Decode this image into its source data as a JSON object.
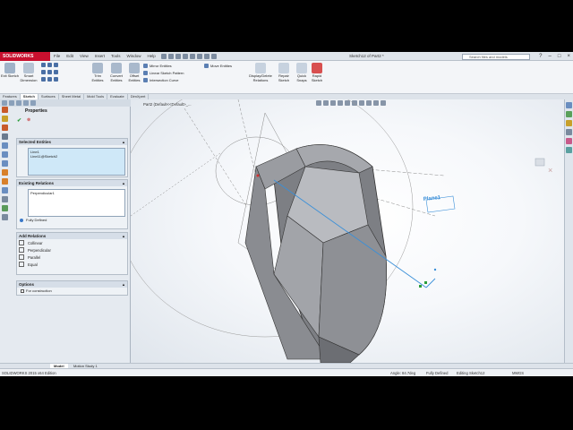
{
  "app": {
    "brand": "SOLIDWORKS",
    "document_title": "Sketch12 of Part2 *",
    "menu": [
      "File",
      "Edit",
      "View",
      "Insert",
      "Tools",
      "Window",
      "Help"
    ],
    "search_placeholder": "Search files and models",
    "window_controls": [
      "?",
      "–",
      "□",
      "×"
    ]
  },
  "commands": {
    "exit_sketch": "Exit Sketch",
    "smart_dimension": "Smart Dimension",
    "trim_entities": "Trim Entities",
    "convert_entities": "Convert Entities",
    "offset_entities": "Offset Entities",
    "mirror_entities": "Mirror Entities",
    "linear_sketch_pattern": "Linear Sketch Pattern",
    "intersection_curve": "Intersection Curve",
    "move_entities": "Move Entities",
    "display_delete_relations": "Display/Delete Relations",
    "repair_sketch": "Repair Sketch",
    "quick_snaps": "Quick Snaps",
    "rapid_sketch": "Rapid Sketch"
  },
  "tabs": [
    "Features",
    "Sketch",
    "Surfaces",
    "Sheet Metal",
    "Mold Tools",
    "Evaluate",
    "DimXpert"
  ],
  "active_tab": "Sketch",
  "property_manager": {
    "title": "Properties",
    "selected_entities": {
      "header": "Selected Entities",
      "items": [
        "Line1",
        "Line11@Sketch2"
      ]
    },
    "existing_relations": {
      "header": "Existing Relations",
      "items": [
        "Perpendicular1"
      ],
      "status": "Fully Defined"
    },
    "add_relations": {
      "header": "Add Relations",
      "items": [
        "Collinear",
        "Perpendicular",
        "Parallel",
        "Equal"
      ]
    },
    "options": {
      "header": "Options",
      "for_construction": "For construction"
    }
  },
  "viewport": {
    "breadcrumb": "Part2 (Default<<Default>_...",
    "plane_label": "Plane1"
  },
  "bottom_tabs": [
    "Model",
    "Motion Study 1"
  ],
  "status": {
    "edition": "SOLIDWORKS 2015 x64 Edition",
    "angle": "Angle: 84.7deg",
    "definition": "Fully Defined",
    "editing": "Editing Sketch12",
    "units": "MMGS"
  },
  "colors": {
    "brand_red": "#c8102e",
    "confirm_green": "#2a9d3a",
    "cancel_red": "#c01818",
    "selection_blue": "#3a8fd8",
    "model_gray": "#7d7f84"
  }
}
